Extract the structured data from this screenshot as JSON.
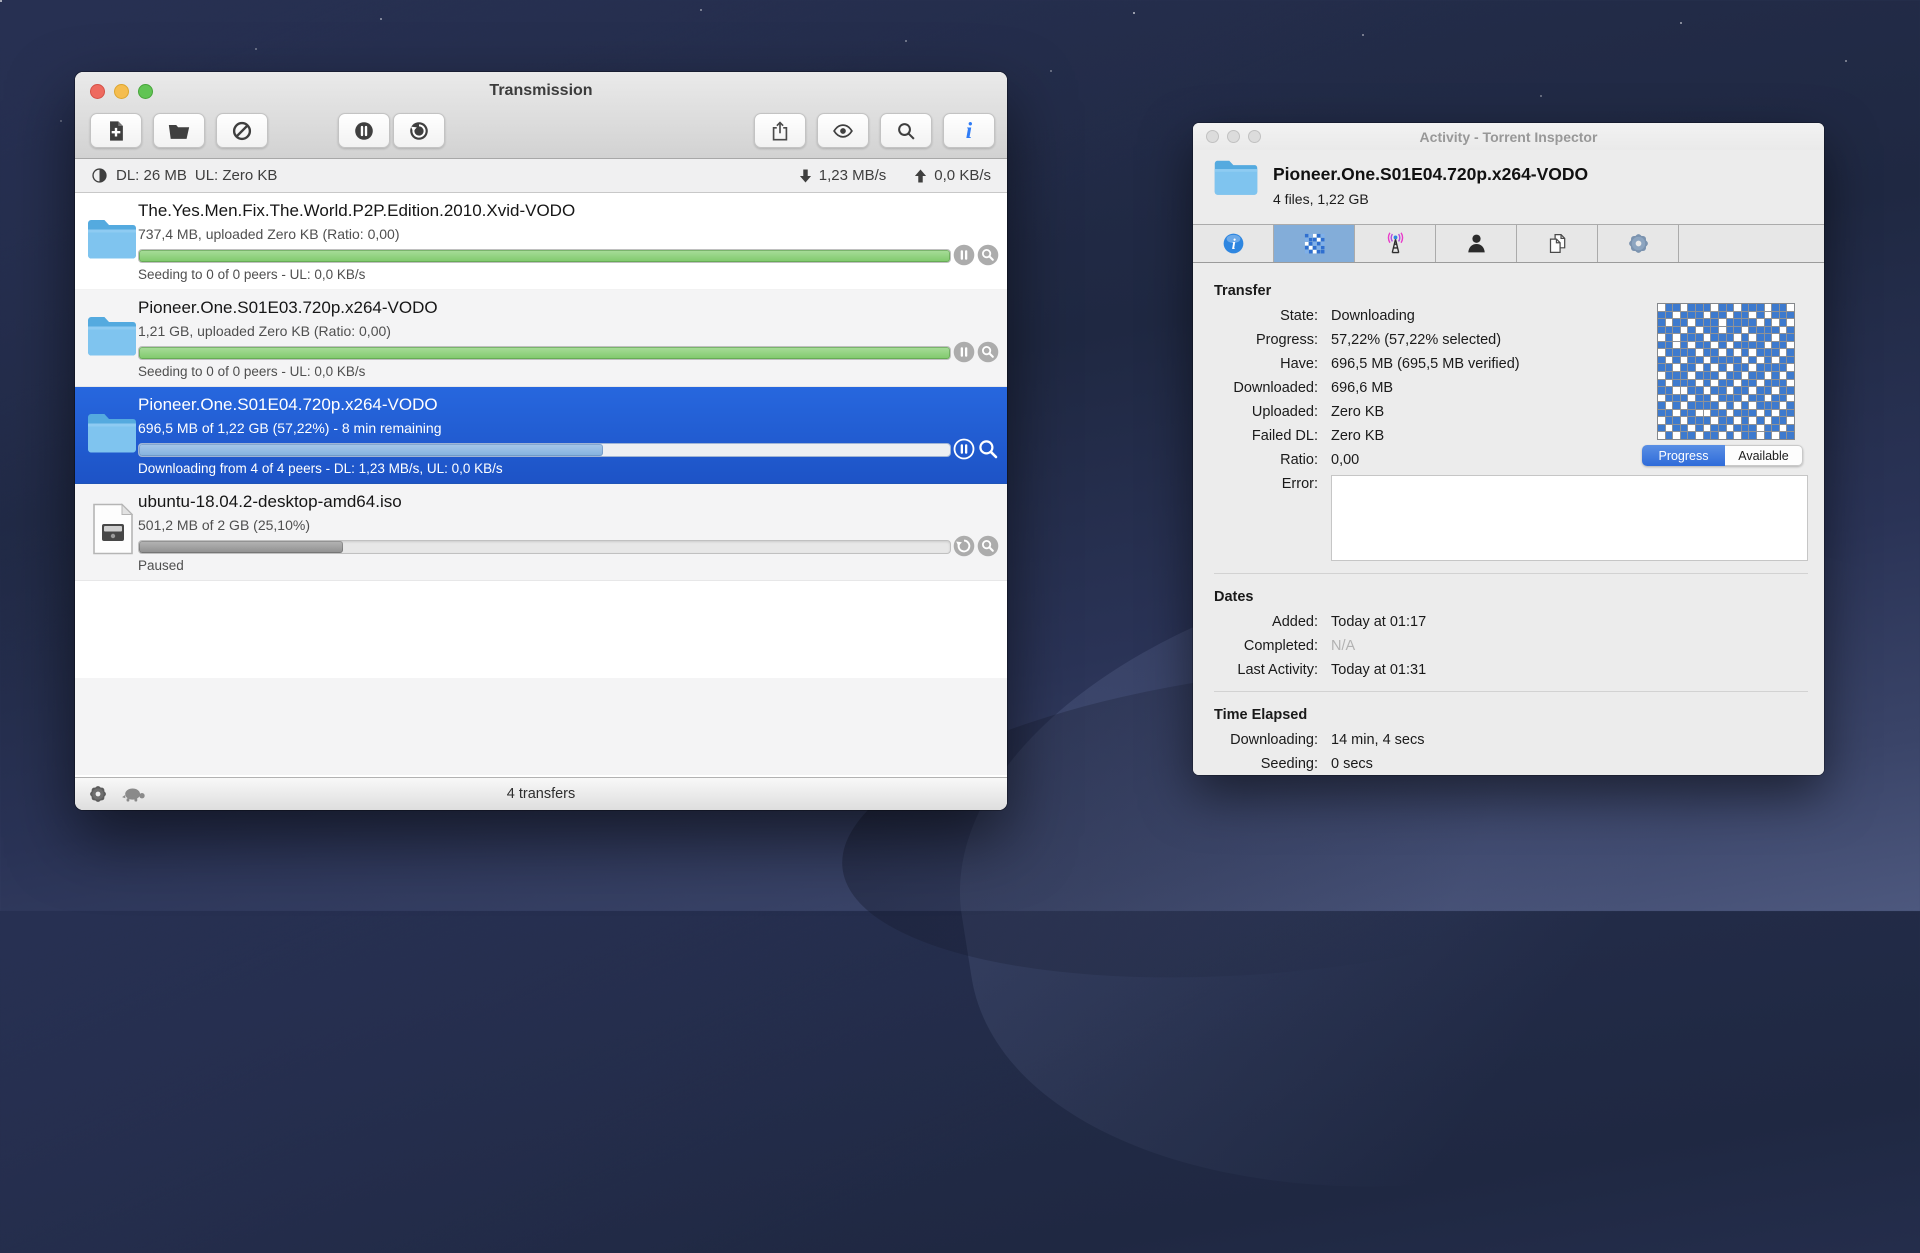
{
  "colors": {
    "selection_blue": "#2160d8",
    "progress_green": "#8fd37d",
    "progress_blue": "#8cb7e1",
    "progress_gray": "#9e9e9e",
    "accent_blue": "#2f7cf6",
    "tracker_magenta": "#e93ec9",
    "pieces_blue": "#3d7ace"
  },
  "transmission": {
    "title": "Transmission",
    "toolbar": {
      "buttons": [
        {
          "icon": "add-torrent-icon",
          "name": "add-torrent-button",
          "group": "left"
        },
        {
          "icon": "open-folder-icon",
          "name": "open-torrent-button",
          "group": "left"
        },
        {
          "icon": "remove-icon",
          "name": "remove-button",
          "group": "left"
        },
        {
          "icon": "pause-all-icon",
          "name": "pause-all-button",
          "group": "center"
        },
        {
          "icon": "resume-all-icon",
          "name": "resume-all-button",
          "group": "center"
        },
        {
          "icon": "share-icon",
          "name": "share-button",
          "group": "right"
        },
        {
          "icon": "quicklook-icon",
          "name": "quicklook-button",
          "group": "right"
        },
        {
          "icon": "search-icon",
          "name": "filter-button",
          "group": "right"
        },
        {
          "icon": "info-icon",
          "name": "inspector-button",
          "group": "right"
        }
      ]
    },
    "statusbar": {
      "stats_icon": "stats-globe-icon",
      "dl_total": "DL: 26 MB",
      "ul_total": "UL: Zero KB",
      "down_icon": "down-arrow-icon",
      "down_speed": "1,23 MB/s",
      "up_icon": "up-arrow-icon",
      "up_speed": "0,0 KB/s"
    },
    "torrents": [
      {
        "name": "The.Yes.Men.Fix.The.World.P2P.Edition.2010.Xvid-VODO",
        "details": "737,4 MB, uploaded Zero KB (Ratio: 0,00)",
        "status": "Seeding to 0 of 0 peers - UL: 0,0 KB/s",
        "progress": 100,
        "bar": "green",
        "icon": "folder-icon",
        "selected": false,
        "actions": [
          "pause",
          "reveal"
        ]
      },
      {
        "name": "Pioneer.One.S01E03.720p.x264-VODO",
        "details": "1,21 GB, uploaded Zero KB (Ratio: 0,00)",
        "status": "Seeding to 0 of 0 peers - UL: 0,0 KB/s",
        "progress": 100,
        "bar": "green",
        "icon": "folder-icon",
        "selected": false,
        "actions": [
          "pause",
          "reveal"
        ]
      },
      {
        "name": "Pioneer.One.S01E04.720p.x264-VODO",
        "details": "696,5 MB of 1,22 GB (57,22%) - 8 min remaining",
        "status": "Downloading from 4 of 4 peers - DL: 1,23 MB/s, UL: 0,0 KB/s",
        "progress": 57.22,
        "bar": "blue",
        "icon": "folder-icon",
        "selected": true,
        "actions": [
          "pause",
          "reveal"
        ]
      },
      {
        "name": "ubuntu-18.04.2-desktop-amd64.iso",
        "details": "501,2 MB of 2 GB (25,10%)",
        "status": "Paused",
        "progress": 25.1,
        "bar": "gray",
        "icon": "disk-image-icon",
        "selected": false,
        "actions": [
          "resume",
          "reveal"
        ]
      }
    ],
    "bottombar": {
      "buttons": [
        {
          "icon": "gear-icon",
          "name": "action-gear-button"
        },
        {
          "icon": "turtle-icon",
          "name": "speed-limit-button"
        }
      ],
      "transfer_count": "4 transfers"
    }
  },
  "inspector": {
    "title": "Activity - Torrent Inspector",
    "header": {
      "icon": "folder-icon",
      "name": "Pioneer.One.S01E04.720p.x264-VODO",
      "info": "4 files, 1,22 GB"
    },
    "tabs": [
      {
        "name": "general",
        "icon": "info-tab-icon",
        "selected": false
      },
      {
        "name": "activity",
        "icon": "activity-tab-icon",
        "selected": true
      },
      {
        "name": "trackers",
        "icon": "tracker-tab-icon",
        "selected": false
      },
      {
        "name": "peers",
        "icon": "peers-tab-icon",
        "selected": false
      },
      {
        "name": "files",
        "icon": "files-tab-icon",
        "selected": false
      },
      {
        "name": "options",
        "icon": "gear-tab-icon",
        "selected": false
      }
    ],
    "transfer": {
      "heading": "Transfer",
      "rows": [
        {
          "label": "State:",
          "value": "Downloading"
        },
        {
          "label": "Progress:",
          "value": "57,22% (57,22% selected)"
        },
        {
          "label": "Have:",
          "value": "696,5 MB (695,5 MB verified)"
        },
        {
          "label": "Downloaded:",
          "value": "696,6 MB"
        },
        {
          "label": "Uploaded:",
          "value": "Zero KB"
        },
        {
          "label": "Failed DL:",
          "value": "Zero KB"
        },
        {
          "label": "Ratio:",
          "value": "0,00"
        }
      ],
      "error_label": "Error:",
      "error_value": ""
    },
    "pieces": {
      "legend_progress": "Progress",
      "legend_available": "Available",
      "legend_selected": "Progress",
      "rows": [
        "011011101101110110",
        "110111011011010111",
        "101101110111101010",
        "111010110110111101",
        "010111011101011011",
        "110101101011110110",
        "011110110101011101",
        "101011011110101011",
        "110110101011011110",
        "011101110110110101",
        "101110101101101110",
        "110011011011011011",
        "011101101110110110",
        "101011110101011101",
        "110110011011101011",
        "011011101101010110",
        "101101011011101101",
        "010110110101101011"
      ]
    },
    "dates": {
      "heading": "Dates",
      "rows": [
        {
          "label": "Added:",
          "value": "Today at 01:17"
        },
        {
          "label": "Completed:",
          "value": "N/A",
          "muted": true
        },
        {
          "label": "Last Activity:",
          "value": "Today at 01:31"
        }
      ]
    },
    "time_elapsed": {
      "heading": "Time Elapsed",
      "rows": [
        {
          "label": "Downloading:",
          "value": "14 min, 4 secs"
        },
        {
          "label": "Seeding:",
          "value": "0 secs"
        }
      ]
    }
  }
}
